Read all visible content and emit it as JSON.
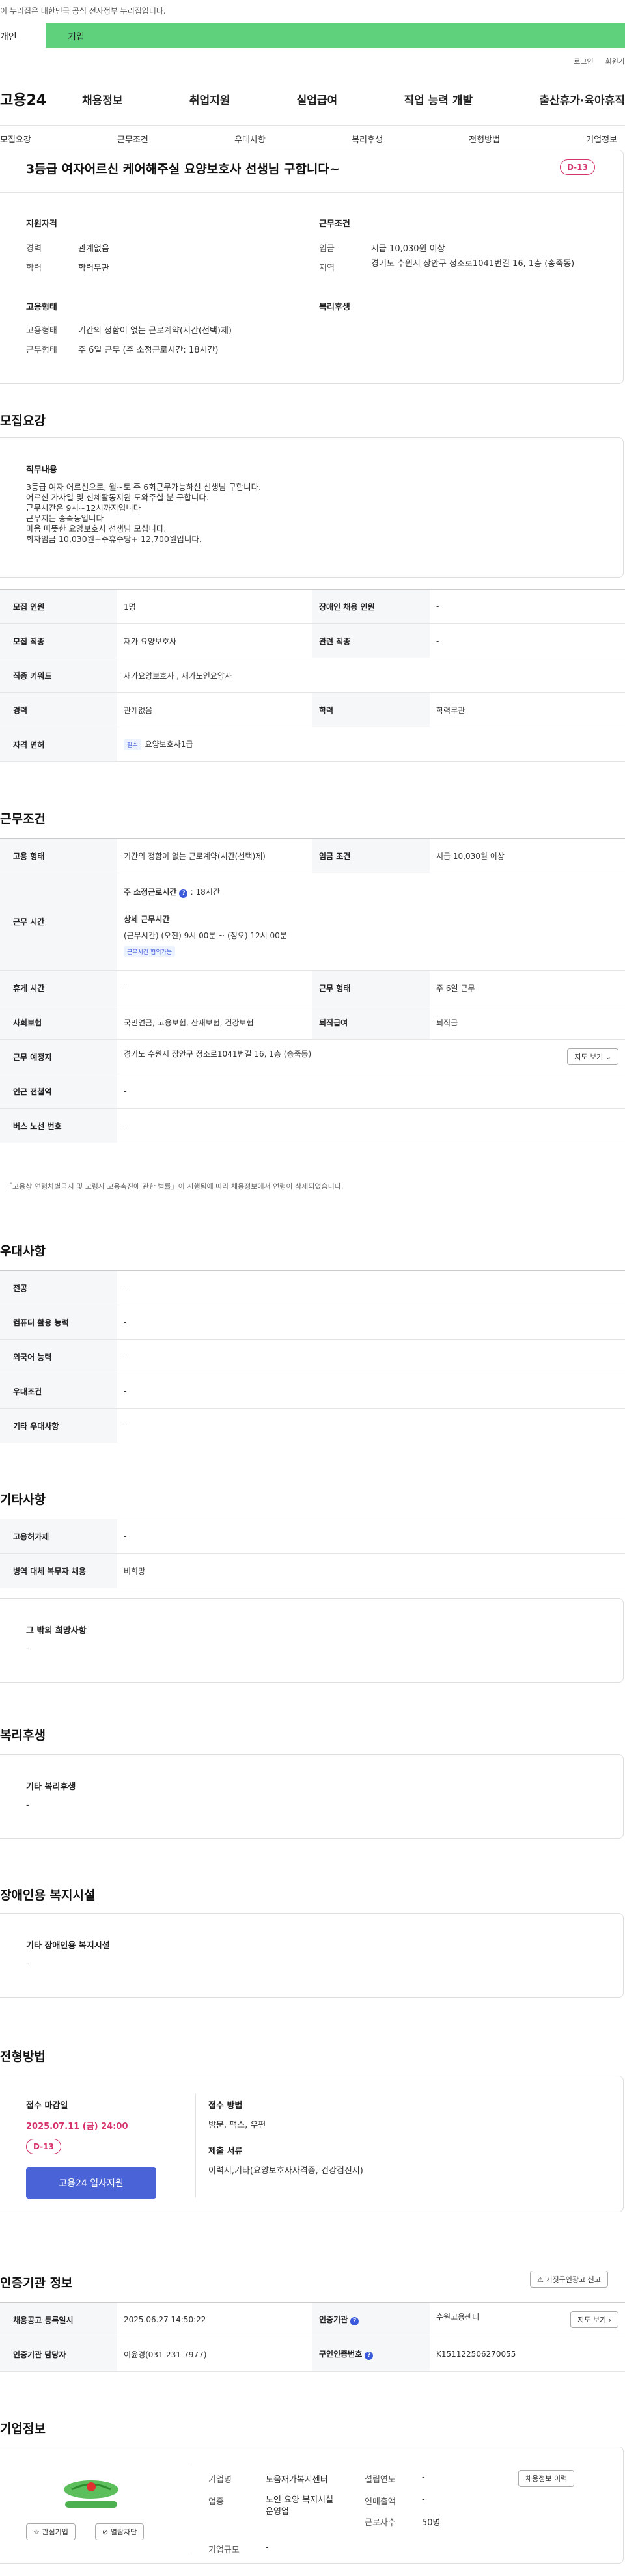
{
  "gov_banner": "이 누리집은 대한민국 공식 전자정부 누리집입니다.",
  "user_tabs": {
    "individual": "개인",
    "company": "기업"
  },
  "util": {
    "login": "로그인",
    "join": "회원가"
  },
  "logo": "고용24",
  "gnb": [
    "채용정보",
    "취업지원",
    "실업급여",
    "직업 능력 개발",
    "출산휴가·육아휴직"
  ],
  "snb": [
    "모집요강",
    "근무조건",
    "우대사항",
    "복리후생",
    "전형방법",
    "기업정보"
  ],
  "header": {
    "title": "3등급 여자어르신 케어해주실 요양보호사 선생님 구합니다~",
    "dday": "D-13",
    "qual_title": "지원자격",
    "exp_label": "경력",
    "exp_val": "관계없음",
    "edu_label": "학력",
    "edu_val": "학력무관",
    "cond_title": "근무조건",
    "wage_label": "임금",
    "wage_val": "시급 10,030원 이상",
    "area_label": "지역",
    "area_val": "경기도 수원시 장안구 정조로1041번길 16, 1층 (송죽동)",
    "emp_title": "고용형태",
    "emptype_label": "고용형태",
    "emptype_val": "기간의 정함이 없는 근로계약(시간(선택)제)",
    "hours_label": "근무형태",
    "hours_val": "주 6일 근무 (주 소정근로시간: 18시간)",
    "welfare_title": "복리후생"
  },
  "recruit": {
    "title": "모집요강",
    "job_title": "직무내용",
    "job_lines": [
      "3등급 여자 어르신으로, 월~토 주 6회근무가능하신 선생님 구합니다.",
      "어르신 가사일 및 신체활동지원 도와주실 분 구합니다.",
      "근무시간은 9시~12시까지입니다",
      "근무지는 송죽동입니다",
      "마음 따뜻한 요양보호사 선생님 모십니다.",
      "회차임금 10,030원+주휴수당+ 12,700원입니다."
    ],
    "rows": [
      {
        "l1": "모집 인원",
        "v1": "1명",
        "l2": "장애인 채용 인원",
        "v2": "-"
      },
      {
        "l1": "모집 직종",
        "v1": "재가 요양보호사",
        "l2": "관련 직종",
        "v2": "-"
      },
      {
        "l1": "직종 키워드",
        "v1": "재가요양보호사 , 재가노인요양사"
      },
      {
        "l1": "경력",
        "v1": "관계없음",
        "l2": "학력",
        "v2": "학력무관"
      },
      {
        "l1": "자격 면허",
        "badge": "필수",
        "v1": "요양보호사1급"
      }
    ]
  },
  "conditions": {
    "title": "근무조건",
    "emp_l": "고용 형태",
    "emp_v": "기간의 정함이 없는 근로계약(시간(선택)제)",
    "wage_l": "임금 조건",
    "wage_v": "시급 10,030원 이상",
    "time_l": "근무 시간",
    "weekly": "주 소정근로시간",
    "weekly_v": ": 18시간",
    "detail_t": "상세 근무시간",
    "detail_v": "(근무시간) (오전) 9시 00분 ~ (정오) 12시 00분",
    "consult": "근무시간 협의가능",
    "holiday_l": "휴게 시간",
    "holiday_v": "-",
    "form_l": "근무 형태",
    "form_v": "주 6일 근무",
    "ins_l": "사회보험",
    "ins_v": "국민연금, 고용보험, 산재보험, 건강보험",
    "sev_l": "퇴직급여",
    "sev_v": "퇴직금",
    "addr_l": "근무 예정지",
    "addr_v": "경기도 수원시 장안구 정조로1041번길 16, 1층 (송죽동)",
    "map_btn": "지도 보기",
    "station_l": "인근 전철역",
    "station_v": "-",
    "bus_l": "버스 노선 번호",
    "bus_v": "-",
    "note": "「고용상 연령차별금지 및 고령자 고용촉진에 관한 법률」이 시행됨에 따라 채용정보에서 연령이 삭제되었습니다."
  },
  "pref": {
    "title": "우대사항",
    "rows": [
      {
        "l": "전공",
        "v": "-"
      },
      {
        "l": "컴퓨터 활용 능력",
        "v": "-"
      },
      {
        "l": "외국어 능력",
        "v": "-"
      },
      {
        "l": "우대조건",
        "v": "-"
      },
      {
        "l": "기타 우대사항",
        "v": "-"
      }
    ]
  },
  "etc": {
    "title": "기타사항",
    "rows": [
      {
        "l": "고용허가제",
        "v": "-"
      },
      {
        "l": "병역 대체 복무자 채용",
        "v": "비희망"
      }
    ],
    "box_t": "그 밖의 희망사항",
    "box_v": "-"
  },
  "welfare": {
    "title": "복리후생",
    "box_t": "기타 복리후생",
    "box_v": "-"
  },
  "disabled": {
    "title": "장애인용 복지시설",
    "box_t": "기타 장애인용 복지시설",
    "box_v": "-"
  },
  "selection": {
    "title": "전형방법",
    "deadline_t": "접수 마감일",
    "deadline_v": "2025.07.11 (금) 24:00",
    "dday": "D-13",
    "apply_btn": "고용24 입사지원",
    "method_t": "접수 방법",
    "method_v": "방문, 팩스, 우편",
    "docs_t": "제출 서류",
    "docs_v": "이력서,기타(요양보호사자격증, 건강검진서)"
  },
  "agency": {
    "title": "인증기관 정보",
    "report_btn": "거짓구인광고 신고",
    "reg_l": "채용공고 등록일시",
    "reg_v": "2025.06.27 14:50:22",
    "org_l": "인증기관",
    "org_v": "수원고용센터",
    "map_btn": "지도 보기",
    "mgr_l": "인증기관 담당자",
    "mgr_v": "이윤경(031-231-7977)",
    "no_l": "구인인증번호",
    "no_v": "K151122506270055"
  },
  "company": {
    "title": "기업정보",
    "name_l": "기업명",
    "name_v": "도움재가복지센터",
    "ind_l": "업종",
    "ind_v": "노인 요양 복지시설 운영업",
    "size_l": "기업규모",
    "size_v": "-",
    "est_l": "설립연도",
    "est_v": "-",
    "sales_l": "연매출액",
    "sales_v": "-",
    "emp_l": "근로자수",
    "emp_v": "50명",
    "history_btn": "채용정보 이력",
    "fav_btn": "관심기업",
    "block_btn": "열람차단"
  }
}
